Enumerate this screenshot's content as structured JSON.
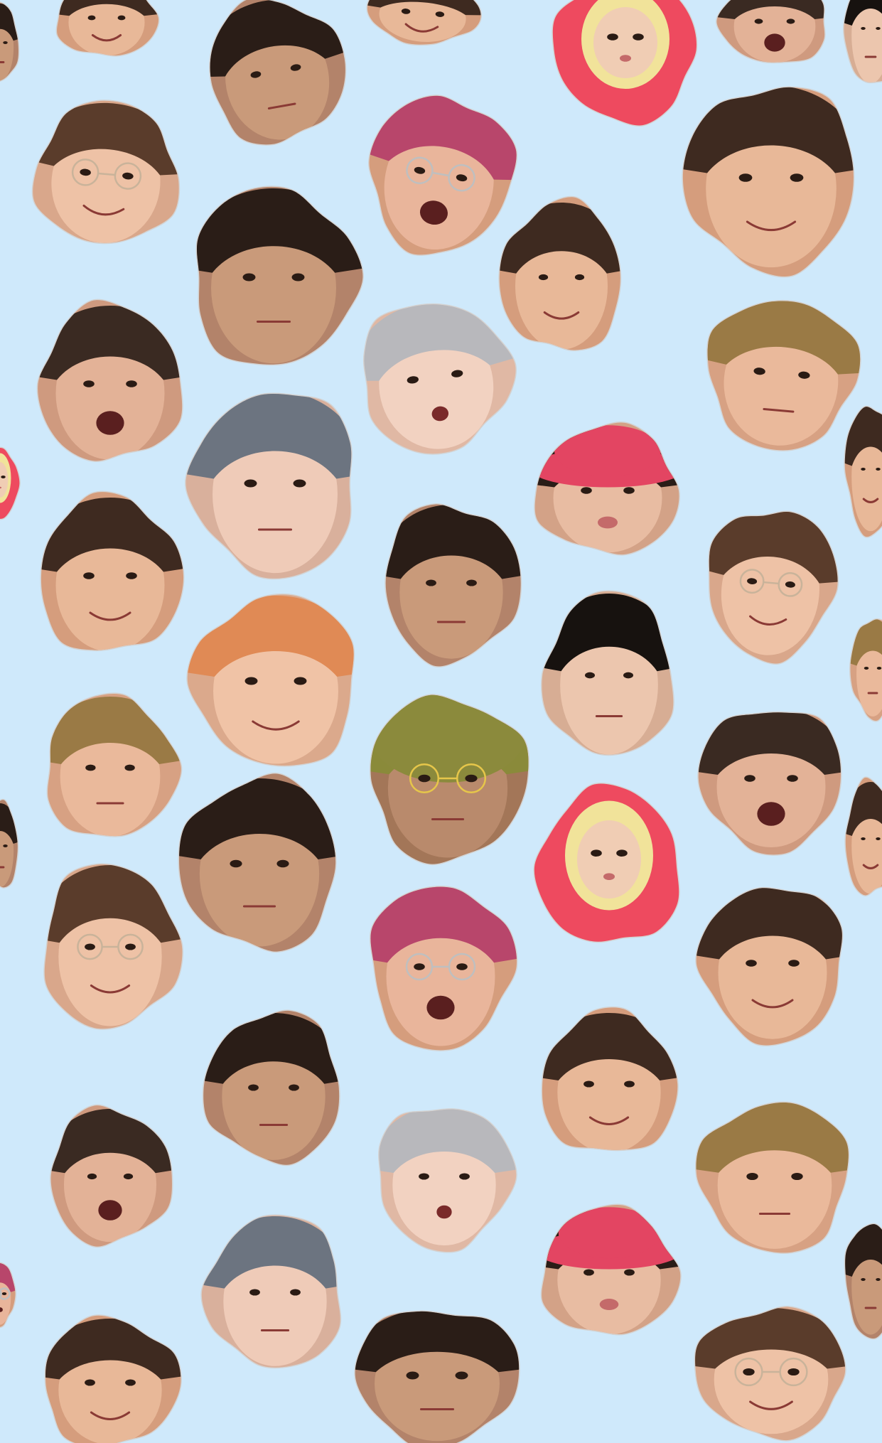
{
  "background_color": "#cfe9fb",
  "sticker_kinds": {
    "boy-brown": {
      "skin": "#e8b898",
      "hair": "#3e2a20",
      "glasses": false,
      "hat": null,
      "mouth": "smile",
      "skin_shadow": "#d59d7d"
    },
    "boy-glasses": {
      "skin": "#eec2a6",
      "hair": "#5a3c2b",
      "glasses": true,
      "glasses_color": "#c9b39a",
      "hat": null,
      "mouth": "smile",
      "skin_shadow": "#d9a78b"
    },
    "boy-dark": {
      "skin": "#c99a7a",
      "hair": "#2a1d17",
      "glasses": false,
      "hat": null,
      "mouth": "neutral",
      "skin_shadow": "#b3836a"
    },
    "boy-pink-hair": {
      "skin": "#e9b59b",
      "hair": "#b8466b",
      "glasses": true,
      "glasses_color": "#bfbfbf",
      "hat": null,
      "mouth": "open",
      "skin_shadow": "#d59d7d"
    },
    "boy-silver-hair": {
      "skin": "#f2d2c1",
      "hair": "#b8b8bc",
      "glasses": false,
      "hat": null,
      "mouth": "open-small",
      "skin_shadow": "#e0b8a4"
    },
    "boy-blonde": {
      "skin": "#eab99b",
      "hair": "#9a7a45",
      "glasses": false,
      "hat": null,
      "mouth": "neutral",
      "skin_shadow": "#d7a183"
    },
    "boy-orange-hair": {
      "skin": "#f0c3a6",
      "hair": "#e08a55",
      "glasses": false,
      "hat": null,
      "mouth": "smile",
      "skin_shadow": "#dba98c"
    },
    "boy-grey-blue": {
      "skin": "#efcbb8",
      "hair": "#6c7480",
      "glasses": false,
      "hat": null,
      "mouth": "neutral",
      "skin_shadow": "#d9b09c"
    },
    "boy-yelling": {
      "skin": "#e3b297",
      "hair": "#3a2a22",
      "glasses": false,
      "hat": null,
      "mouth": "yell",
      "skin_shadow": "#cf9a7f"
    },
    "boy-red-hat": {
      "skin": "#e8bca2",
      "hair": "#2a1d17",
      "glasses": false,
      "hat": "bucket",
      "hat_color": "#e34562",
      "mouth": "pout",
      "skin_shadow": "#d3a287"
    },
    "boy-red-costume": {
      "skin": "#f0cdb4",
      "hair": "#d6c87a",
      "glasses": false,
      "hat": "costume",
      "hat_color": "#ee4a5f",
      "mouth": "pout",
      "skin_shadow": "#dcb49b"
    },
    "boy-green-cap": {
      "skin": "#b98a6c",
      "hair": "#8a8a3a",
      "glasses": true,
      "glasses_color": "#e6c64a",
      "hat": "beanie",
      "hat_color": "#8b8a3c",
      "mouth": "neutral",
      "skin_shadow": "#a37658"
    },
    "boy-black-hair": {
      "skin": "#ecc6ae",
      "hair": "#17120f",
      "glasses": false,
      "hat": null,
      "mouth": "neutral",
      "skin_shadow": "#d7ad94"
    }
  },
  "stickers": [
    {
      "id": "s01",
      "kind": "boy-brown"
    },
    {
      "id": "s02",
      "kind": "boy-dark"
    },
    {
      "id": "s03",
      "kind": "boy-brown"
    },
    {
      "id": "s04",
      "kind": "boy-red-costume"
    },
    {
      "id": "s05",
      "kind": "boy-yelling"
    },
    {
      "id": "s06",
      "kind": "boy-glasses"
    },
    {
      "id": "s07",
      "kind": "boy-dark"
    },
    {
      "id": "s08",
      "kind": "boy-pink-hair"
    },
    {
      "id": "s09",
      "kind": "boy-brown"
    },
    {
      "id": "s10",
      "kind": "boy-brown"
    },
    {
      "id": "s11",
      "kind": "boy-yelling"
    },
    {
      "id": "s12",
      "kind": "boy-silver-hair"
    },
    {
      "id": "s13",
      "kind": "boy-blonde"
    },
    {
      "id": "s14",
      "kind": "boy-grey-blue"
    },
    {
      "id": "s15",
      "kind": "boy-red-hat"
    },
    {
      "id": "s16",
      "kind": "boy-brown"
    },
    {
      "id": "s17",
      "kind": "boy-dark"
    },
    {
      "id": "s18",
      "kind": "boy-glasses"
    },
    {
      "id": "s19",
      "kind": "boy-orange-hair"
    },
    {
      "id": "s20",
      "kind": "boy-black-hair"
    },
    {
      "id": "s21",
      "kind": "boy-blonde"
    },
    {
      "id": "s22",
      "kind": "boy-green-cap"
    },
    {
      "id": "s23",
      "kind": "boy-yelling"
    },
    {
      "id": "s24",
      "kind": "boy-dark"
    },
    {
      "id": "s25",
      "kind": "boy-red-costume"
    },
    {
      "id": "s26",
      "kind": "boy-glasses"
    },
    {
      "id": "s27",
      "kind": "boy-pink-hair"
    },
    {
      "id": "s28",
      "kind": "boy-brown"
    },
    {
      "id": "s29",
      "kind": "boy-dark"
    },
    {
      "id": "s30",
      "kind": "boy-brown"
    },
    {
      "id": "s31",
      "kind": "boy-yelling"
    },
    {
      "id": "s32",
      "kind": "boy-silver-hair"
    },
    {
      "id": "s33",
      "kind": "boy-blonde"
    },
    {
      "id": "s34",
      "kind": "boy-grey-blue"
    },
    {
      "id": "s35",
      "kind": "boy-red-hat"
    },
    {
      "id": "s36",
      "kind": "boy-brown"
    },
    {
      "id": "s37",
      "kind": "boy-dark"
    },
    {
      "id": "s38",
      "kind": "boy-glasses"
    },
    {
      "id": "s39",
      "kind": "boy-black-hair"
    },
    {
      "id": "s40",
      "kind": "boy-dark"
    },
    {
      "id": "s41",
      "kind": "boy-red-costume"
    },
    {
      "id": "s42",
      "kind": "boy-brown"
    },
    {
      "id": "s43",
      "kind": "boy-blonde"
    },
    {
      "id": "s44",
      "kind": "boy-dark"
    },
    {
      "id": "s45",
      "kind": "boy-brown"
    },
    {
      "id": "s46",
      "kind": "boy-pink-hair"
    },
    {
      "id": "s47",
      "kind": "boy-dark"
    }
  ]
}
